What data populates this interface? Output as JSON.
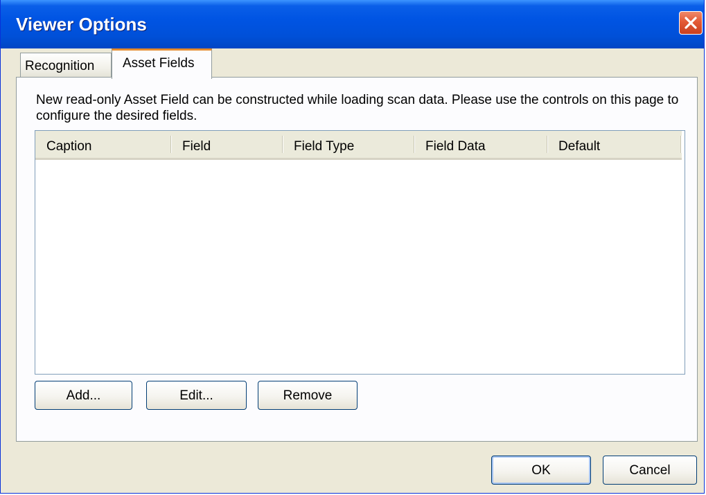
{
  "window": {
    "title": "Viewer Options"
  },
  "tabs": [
    {
      "label": "Recognition",
      "selected": false
    },
    {
      "label": "Asset Fields",
      "selected": true
    }
  ],
  "asset_fields": {
    "description": "New read-only Asset Field can be constructed while loading scan data.  Please use the controls on this page to configure the desired fields.",
    "columns": [
      "Caption",
      "Field",
      "Field Type",
      "Field Data",
      "Default"
    ],
    "rows": [],
    "add_label": "Add...",
    "edit_label": "Edit...",
    "remove_label": "Remove"
  },
  "footer": {
    "ok_label": "OK",
    "cancel_label": "Cancel"
  },
  "icons": {
    "close": "close-icon"
  },
  "colors": {
    "titlebar": "#0054e3",
    "close_button": "#e35a36",
    "active_tab_accent": "#e68b2c",
    "dialog_face": "#ece9d8"
  }
}
